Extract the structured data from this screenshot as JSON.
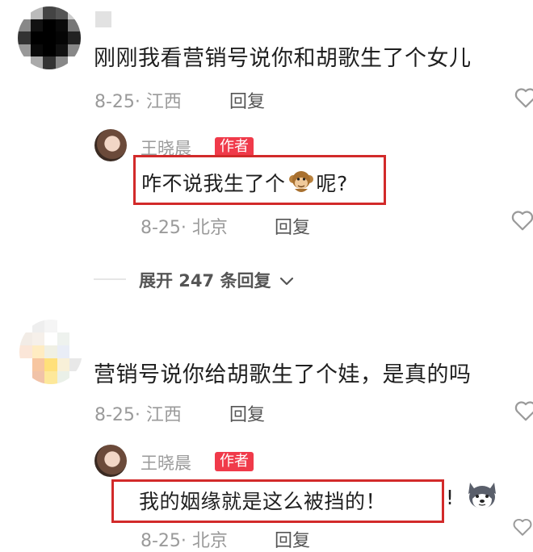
{
  "comments": [
    {
      "text": "刚刚我看营销号说你和胡歌生了个女儿",
      "date_location": "8-25· 江西",
      "reply_label": "回复",
      "reply": {
        "username": "王晓晨",
        "badge": "作者",
        "text_before": "咋不说我生了个",
        "emoji": "monkey-emoji",
        "text_after": "呢?",
        "date_location": "8-25· 北京",
        "reply_label": "回复"
      },
      "expand_label": "展开 247 条回复"
    },
    {
      "text": "营销号说你给胡歌生了个娃，是真的吗",
      "date_location": "8-25· 江西",
      "reply_label": "回复",
      "reply": {
        "username": "王晓晨",
        "badge": "作者",
        "text": "我的姻缘就是这么被挡的！",
        "trailing": "!",
        "emoji": "husky-emoji",
        "date_location": "8-25· 北京",
        "reply_label": "回复"
      }
    }
  ],
  "colors": {
    "badge": "#f03a4a",
    "highlight": "#d22a2a"
  },
  "icons": [
    "heart-icon",
    "chevron-down-icon"
  ]
}
